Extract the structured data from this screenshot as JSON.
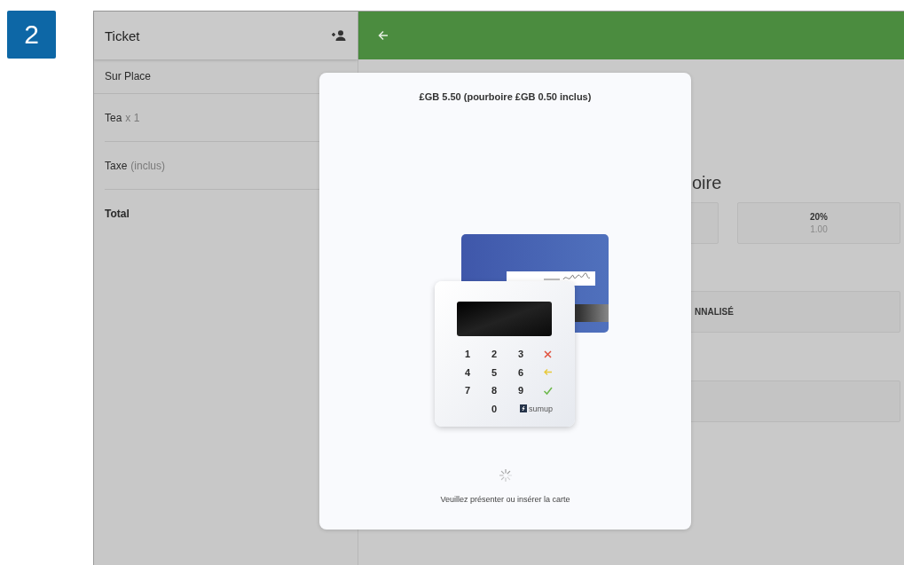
{
  "step_badge": "2",
  "ticket_panel": {
    "title": "Ticket",
    "rows": [
      {
        "kind": "plain",
        "label": "Sur Place"
      },
      {
        "kind": "item",
        "label": "Tea",
        "detail": "x 1"
      },
      {
        "kind": "item",
        "label": "Taxe",
        "detail": "(inclus)"
      },
      {
        "kind": "total",
        "label": "Total"
      }
    ]
  },
  "tip_screen": {
    "heading": "oire",
    "options": [
      {
        "kind": "hidden"
      },
      {
        "kind": "percent",
        "label": "20%",
        "amount": "1.00"
      }
    ],
    "custom_button": "NNALISÉ"
  },
  "payment_dialog": {
    "amount": "£GB 5.50 (pourboire £GB 0.50 inclus)",
    "keypad": [
      {
        "kind": "digit",
        "label": "1"
      },
      {
        "kind": "digit",
        "label": "2"
      },
      {
        "kind": "digit",
        "label": "3"
      },
      {
        "kind": "cancel"
      },
      {
        "kind": "digit",
        "label": "4"
      },
      {
        "kind": "digit",
        "label": "5"
      },
      {
        "kind": "digit",
        "label": "6"
      },
      {
        "kind": "back"
      },
      {
        "kind": "digit",
        "label": "7"
      },
      {
        "kind": "digit",
        "label": "8"
      },
      {
        "kind": "digit",
        "label": "9"
      },
      {
        "kind": "ok"
      },
      {
        "kind": "empty"
      },
      {
        "kind": "digit",
        "label": "0"
      },
      {
        "kind": "empty"
      },
      {
        "kind": "brand",
        "label": "sumup"
      }
    ],
    "loading": true,
    "message": "Veuillez présenter ou insérer la carte"
  }
}
